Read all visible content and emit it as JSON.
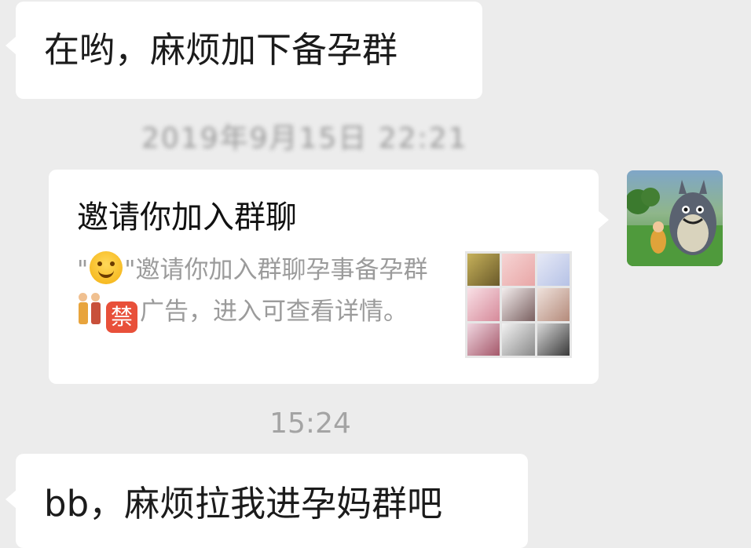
{
  "messages": {
    "first": "在哟，麻烦加下备孕群",
    "timestamp_blurred": "2019年9月15日 22:21",
    "invite_title": "邀请你加入群聊",
    "invite_desc_part1": "邀请你加入群聊孕事备孕群",
    "invite_desc_ban": "禁",
    "invite_desc_part2": "广告，进入可查看详情。",
    "time": "15:24",
    "second": "bb，麻烦拉我进孕妈群吧"
  },
  "icons": {
    "inviter_emoji": "smiling-face-icon",
    "couple_emoji": "couple-icon",
    "ban_emoji": "prohibited-icon",
    "group_avatar": "group-avatar-grid-icon",
    "user_avatar": "totoro-avatar-icon"
  },
  "colors": {
    "background": "#ececec",
    "bubble": "#ffffff",
    "secondary_text": "#9b9b9b",
    "ban_badge": "#e8503a"
  }
}
